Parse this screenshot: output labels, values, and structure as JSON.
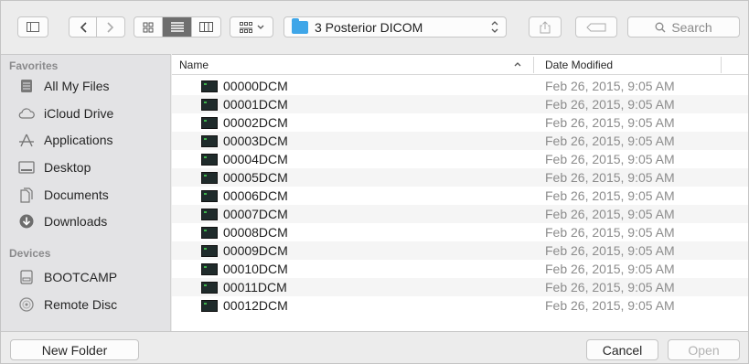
{
  "toolbar": {
    "path_folder": "3 Posterior DICOM",
    "search_placeholder": "Search"
  },
  "sidebar": {
    "favorites_header": "Favorites",
    "favorites": [
      {
        "label": "All My Files",
        "icon": "all-files-icon"
      },
      {
        "label": "iCloud Drive",
        "icon": "cloud-icon"
      },
      {
        "label": "Applications",
        "icon": "applications-icon"
      },
      {
        "label": "Desktop",
        "icon": "desktop-icon"
      },
      {
        "label": "Documents",
        "icon": "documents-icon"
      },
      {
        "label": "Downloads",
        "icon": "downloads-icon"
      }
    ],
    "devices_header": "Devices",
    "devices": [
      {
        "label": "BOOTCAMP",
        "icon": "disk-icon"
      },
      {
        "label": "Remote Disc",
        "icon": "disc-icon"
      }
    ]
  },
  "filelist": {
    "col_name": "Name",
    "col_date": "Date Modified",
    "sort_indicator": "^",
    "rows": [
      {
        "name": "00000DCM",
        "date": "Feb 26, 2015, 9:05 AM"
      },
      {
        "name": "00001DCM",
        "date": "Feb 26, 2015, 9:05 AM"
      },
      {
        "name": "00002DCM",
        "date": "Feb 26, 2015, 9:05 AM"
      },
      {
        "name": "00003DCM",
        "date": "Feb 26, 2015, 9:05 AM"
      },
      {
        "name": "00004DCM",
        "date": "Feb 26, 2015, 9:05 AM"
      },
      {
        "name": "00005DCM",
        "date": "Feb 26, 2015, 9:05 AM"
      },
      {
        "name": "00006DCM",
        "date": "Feb 26, 2015, 9:05 AM"
      },
      {
        "name": "00007DCM",
        "date": "Feb 26, 2015, 9:05 AM"
      },
      {
        "name": "00008DCM",
        "date": "Feb 26, 2015, 9:05 AM"
      },
      {
        "name": "00009DCM",
        "date": "Feb 26, 2015, 9:05 AM"
      },
      {
        "name": "00010DCM",
        "date": "Feb 26, 2015, 9:05 AM"
      },
      {
        "name": "00011DCM",
        "date": "Feb 26, 2015, 9:05 AM"
      },
      {
        "name": "00012DCM",
        "date": "Feb 26, 2015, 9:05 AM"
      }
    ]
  },
  "bottom": {
    "new_folder": "New Folder",
    "cancel": "Cancel",
    "open": "Open"
  },
  "colors": {
    "folder_accent": "#3fa6e8",
    "selected_segment": "#6e6e6e"
  }
}
